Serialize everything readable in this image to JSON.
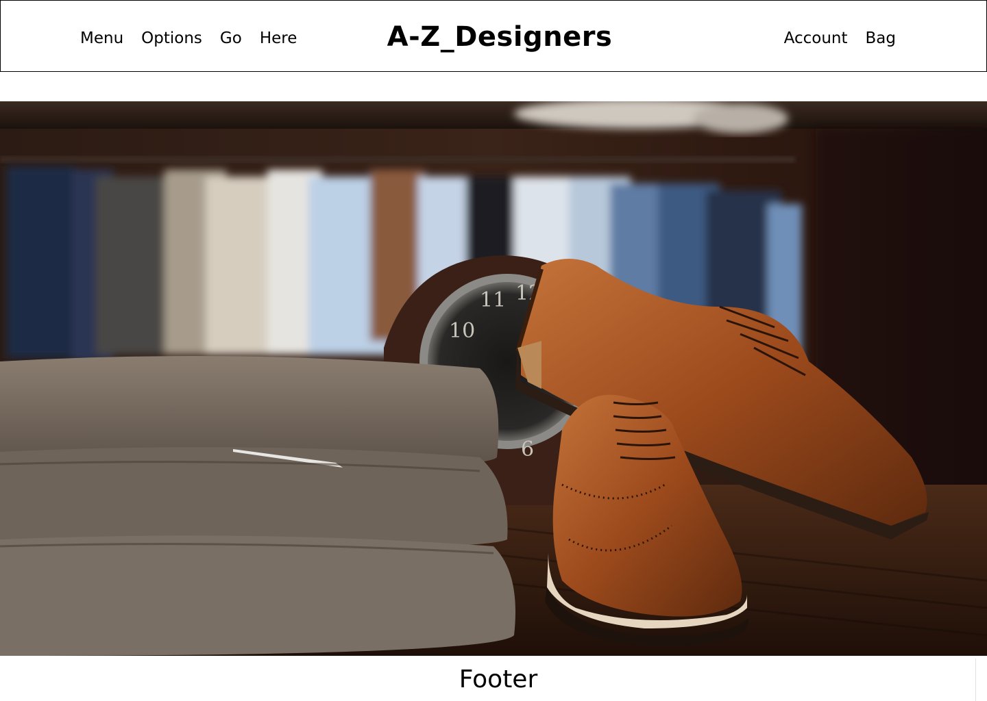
{
  "header": {
    "nav_left": [
      "Menu",
      "Options",
      "Go",
      "Here"
    ],
    "brand": "A-Z_Designers",
    "nav_right": [
      "Account",
      "Bag"
    ]
  },
  "hero": {
    "subject": "store display with leather brogue shoes, folded sweaters, clock and hanging shirts"
  },
  "footer": {
    "label": "Footer"
  },
  "colors": {
    "border": "#000000",
    "background": "#ffffff",
    "leather": "#a0501e",
    "sweater": "#7b6e62"
  }
}
